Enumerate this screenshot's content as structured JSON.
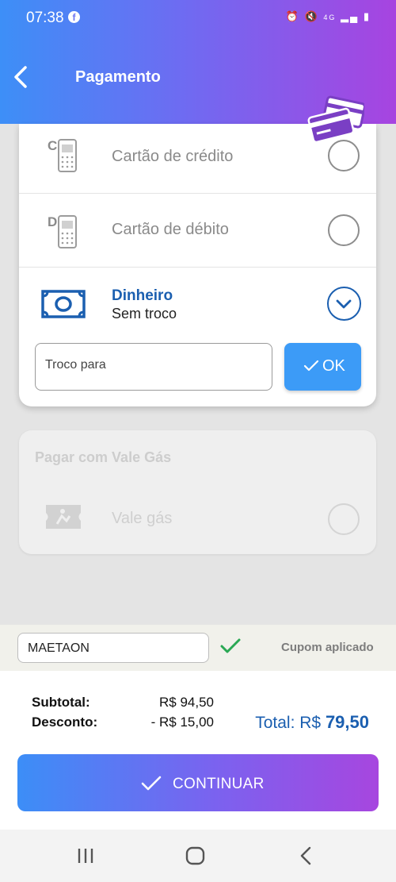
{
  "status_bar": {
    "time": "07:38",
    "network": "4G"
  },
  "header": {
    "title": "Pagamento"
  },
  "payment_options": [
    {
      "label": "Cartão de crédito",
      "icon": "credit-card-terminal-icon"
    },
    {
      "label": "Cartão de débito",
      "icon": "debit-card-terminal-icon"
    }
  ],
  "cash": {
    "title": "Dinheiro",
    "subtitle": "Sem troco",
    "troco_placeholder": "Troco para",
    "ok_label": "OK"
  },
  "vale": {
    "title": "Pagar com Vale Gás",
    "option_label": "Vale gás"
  },
  "coupon": {
    "code": "MAETAON",
    "status": "Cupom aplicado"
  },
  "summary": {
    "subtotal_label": "Subtotal:",
    "subtotal_value": "R$ 94,50",
    "discount_label": "Desconto:",
    "discount_value": "- R$ 15,00",
    "total_label": "Total: R$",
    "total_value": "79,50"
  },
  "continue_label": "CONTINUAR",
  "colors": {
    "accent_blue": "#1b5fb0",
    "gradient_start": "#3d8ff7",
    "gradient_end": "#a744e0",
    "ok_button": "#3c9bf7",
    "check_green": "#2aa854"
  }
}
